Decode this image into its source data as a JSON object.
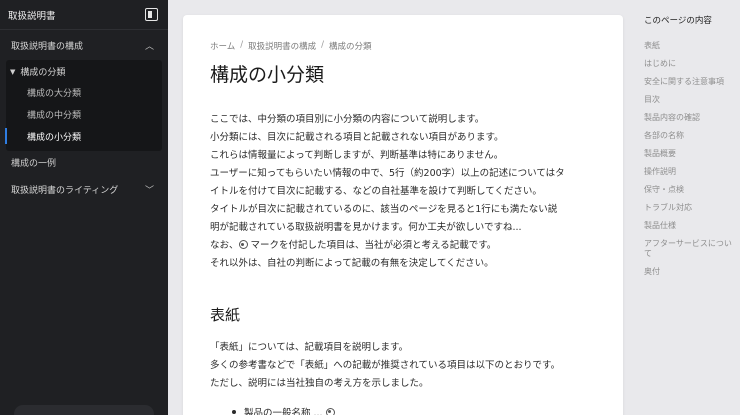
{
  "sidebar": {
    "title": "取扱説明書",
    "sections": [
      {
        "label": "取扱説明書の構成"
      },
      {
        "label": "取扱説明書のライティング"
      }
    ],
    "group_label": "構成の分類",
    "group_items": [
      "構成の大分類",
      "構成の中分類",
      "構成の小分類"
    ],
    "plain_item": "構成の一例"
  },
  "main": {
    "breadcrumbs": [
      "ホーム",
      "取扱説明書の構成",
      "構成の分類"
    ],
    "breadcrumb_sep": "/",
    "title": "構成の小分類",
    "intro": [
      "ここでは、中分類の項目別に小分類の内容について説明します。",
      "小分類には、目次に記載される項目と記載されない項目があります。",
      "これらは情報量によって判断しますが、判断基準は特にありません。",
      "ユーザーに知ってもらいたい情報の中で、5行（約200字）以上の記述についてはタ",
      "イトルを付けて目次に記載する、などの自社基準を設けて判断してください。",
      "タイトルが目次に記載されているのに、該当のページを見ると1行にも満たない説",
      "明が記載されている取扱説明書を見かけます。何か工夫が欲しいですね...",
      "それ以外は、自社の判断によって記載の有無を決定してください。"
    ],
    "intro_mark_prefix": "なお、",
    "intro_mark_suffix": " マークを付記した項目は、当社が必須と考える記載です。",
    "section_title": "表紙",
    "section_body": [
      "「表紙」については、記載項目を説明します。",
      "多くの参考書などで「表紙」への記載が推奨されている項目は以下のとおりです。",
      "ただし、説明には当社独自の考え方を示しました。"
    ],
    "bullet_first": "製品の一般名称 ..."
  },
  "toc": {
    "title": "このページの内容",
    "items": [
      "表紙",
      "はじめに",
      "安全に関する注意事項",
      "目次",
      "製品内容の確認",
      "各部の名称",
      "製品概要",
      "操作説明",
      "保守・点検",
      "トラブル対応",
      "製品仕様",
      "アフターサービスについて",
      "奥付"
    ]
  }
}
